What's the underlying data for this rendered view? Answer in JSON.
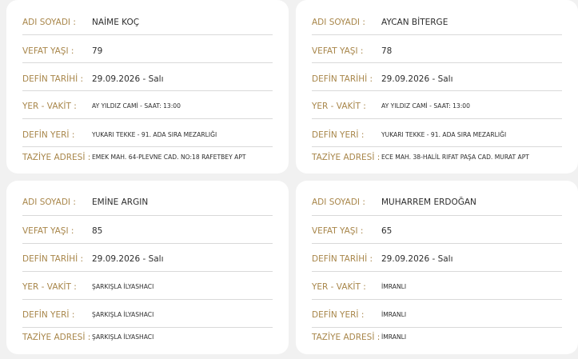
{
  "labels": {
    "name": "ADI SOYADI :",
    "age": "VEFAT YAŞI :",
    "burial_date": "DEFİN TARİHİ :",
    "place_time": "YER - VAKİT :",
    "burial_place": "DEFİN YERİ :",
    "condolence_address": "TAZİYE ADRESİ :"
  },
  "cards": [
    {
      "name": "NAİME KOÇ",
      "age": "79",
      "burial_date": "29.09.2026 - Salı",
      "place_time": "AY YILDIZ CAMİ - SAAT: 13:00",
      "burial_place": "YUKARI TEKKE - 91. ADA SIRA MEZARLIĞI",
      "condolence_address": "EMEK MAH. 64-PLEVNE CAD. NO:18 RAFETBEY APT"
    },
    {
      "name": "AYCAN BİTERGE",
      "age": "78",
      "burial_date": "29.09.2026 - Salı",
      "place_time": "AY YILDIZ CAMİ - SAAT: 13:00",
      "burial_place": "YUKARI TEKKE - 91. ADA SIRA MEZARLIĞI",
      "condolence_address": "ECE MAH. 38-HALİL RIFAT PAŞA CAD. MURAT APT"
    },
    {
      "name": "EMİNE ARGIN",
      "age": "85",
      "burial_date": "29.09.2026 - Salı",
      "place_time": "ŞARKIŞLA İLYASHACI",
      "burial_place": "ŞARKIŞLA İLYASHACI",
      "condolence_address": "ŞARKIŞLA İLYASHACI"
    },
    {
      "name": "MUHARREM ERDOĞAN",
      "age": "65",
      "burial_date": "29.09.2026 - Salı",
      "place_time": "İMRANLI",
      "burial_place": "İMRANLI",
      "condolence_address": "İMRANLI"
    }
  ]
}
